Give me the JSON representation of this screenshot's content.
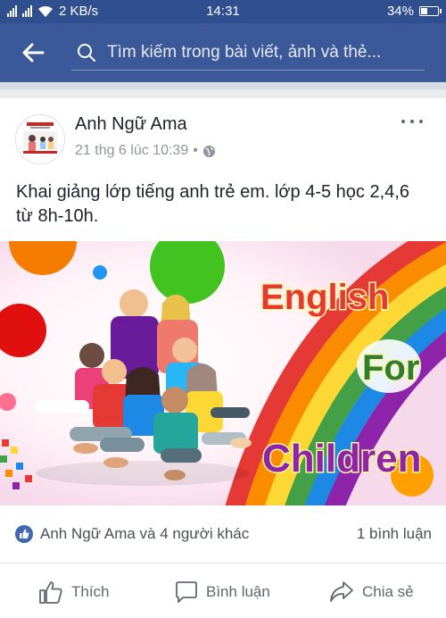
{
  "status_bar": {
    "network_speed": "2 KB/s",
    "time": "14:31",
    "battery": "34%",
    "battery_level": 0.34
  },
  "search": {
    "placeholder": "Tìm kiếm trong bài viết, ảnh và thẻ..."
  },
  "post": {
    "author": "Anh Ngữ Ama",
    "timestamp": "21 thg 6 lúc 10:39",
    "separator": "•",
    "privacy_icon": "globe-icon",
    "text": "Khai giảng lớp tiếng anh trẻ em. lớp 4-5 học 2,4,6 từ 8h-10h.",
    "image": {
      "line1": "English",
      "line2": "For",
      "line3": "Children"
    },
    "likes_text": "Anh Ngữ Ama và 4 người khác",
    "comments_text": "1 bình luận"
  },
  "actions": {
    "like": "Thích",
    "comment": "Bình luận",
    "share": "Chia sẻ"
  },
  "colors": {
    "header": "#3b5998",
    "status_bar": "#2f4f8f",
    "like_blue": "#4267b2"
  }
}
